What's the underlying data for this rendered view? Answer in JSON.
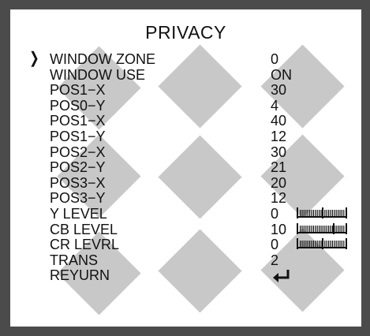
{
  "menu": {
    "title": "PRIVACY",
    "cursor_icon": "arrow-right-icon",
    "items": [
      {
        "label": "WINDOW ZONE",
        "value": "0",
        "selected": true
      },
      {
        "label": "WINDOW USE",
        "value": "ON"
      },
      {
        "label": "POS1−X",
        "value": "30"
      },
      {
        "label": "POS0−Y",
        "value": "4"
      },
      {
        "label": "POS1−X",
        "value": "40"
      },
      {
        "label": "POS1−Y",
        "value": "12"
      },
      {
        "label": "POS2−X",
        "value": "30"
      },
      {
        "label": "POS2−Y",
        "value": "21"
      },
      {
        "label": "POS3−X",
        "value": "20"
      },
      {
        "label": "POS3−Y",
        "value": "12"
      },
      {
        "label": "Y LEVEL",
        "value": "0",
        "level_bar": true
      },
      {
        "label": "CB LEVEL",
        "value": "10",
        "level_bar": true
      },
      {
        "label": "CR LEVRL",
        "value": "0",
        "level_bar": true
      },
      {
        "label": "TRANS",
        "value": "2"
      },
      {
        "label": "REYURN",
        "value": "",
        "icon": "return-enter-icon"
      }
    ]
  },
  "colors": {
    "frame": "#4b4b4b",
    "screen": "#ffffff",
    "mask": "#c8c8c8",
    "text": "#111111"
  }
}
